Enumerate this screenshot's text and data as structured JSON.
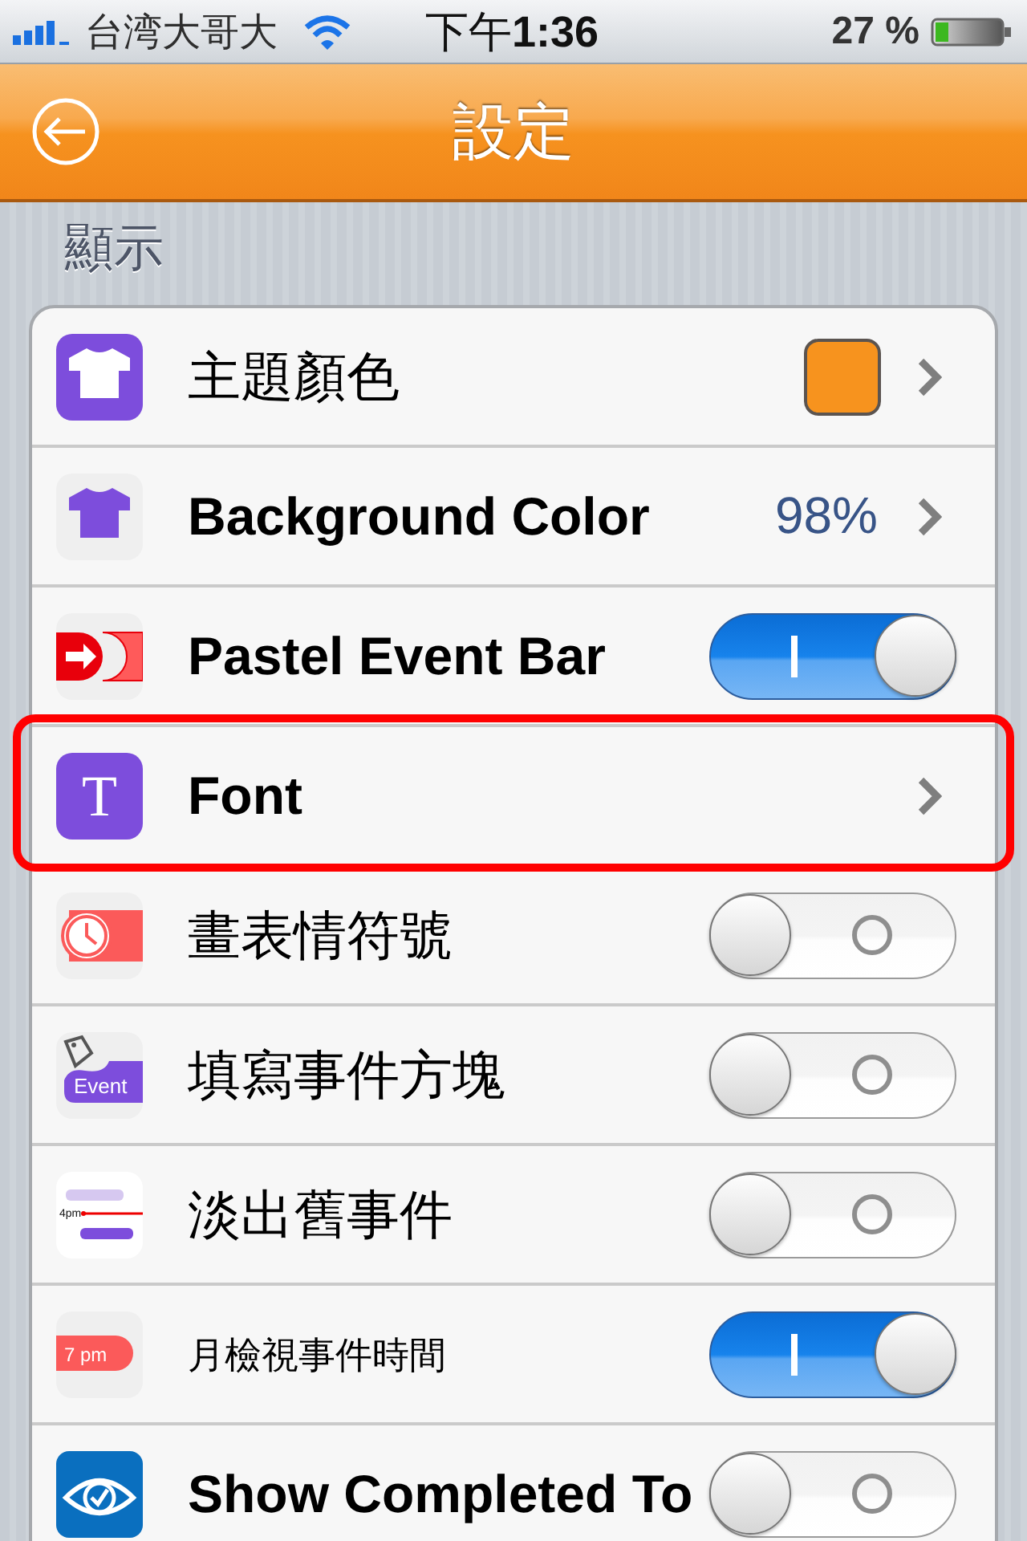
{
  "status_bar": {
    "carrier": "台湾大哥大",
    "time": "下午**1:36**",
    "battery": "27 %"
  },
  "nav_bar": {
    "title": "設定"
  },
  "section": {
    "title": "顯示"
  },
  "items": [
    {
      "kind": "swatch",
      "label": "主題顏色",
      "color": "#f7931e",
      "highlighted": false
    },
    {
      "kind": "value",
      "label": "Background Color",
      "value": "98%",
      "highlighted": false
    },
    {
      "kind": "toggle",
      "label": "Pastel Event Bar",
      "on": true,
      "highlighted": false
    },
    {
      "kind": "link",
      "label": "Font",
      "icon_text": "T",
      "highlighted": true
    },
    {
      "kind": "toggle",
      "label": "畫表情符號",
      "on": false,
      "highlighted": false
    },
    {
      "kind": "toggle",
      "label": "填寫事件方塊",
      "icon_text": "Event",
      "on": false,
      "highlighted": false
    },
    {
      "kind": "toggle",
      "label": "淡出舊事件",
      "icon_text": "4pm",
      "on": false,
      "highlighted": false
    },
    {
      "kind": "toggle",
      "label": "月檢視事件時間",
      "icon_text": "7 pm",
      "on": true,
      "highlighted": false
    },
    {
      "kind": "toggle",
      "label": "Show Completed To",
      "on": false,
      "highlighted": false
    }
  ]
}
